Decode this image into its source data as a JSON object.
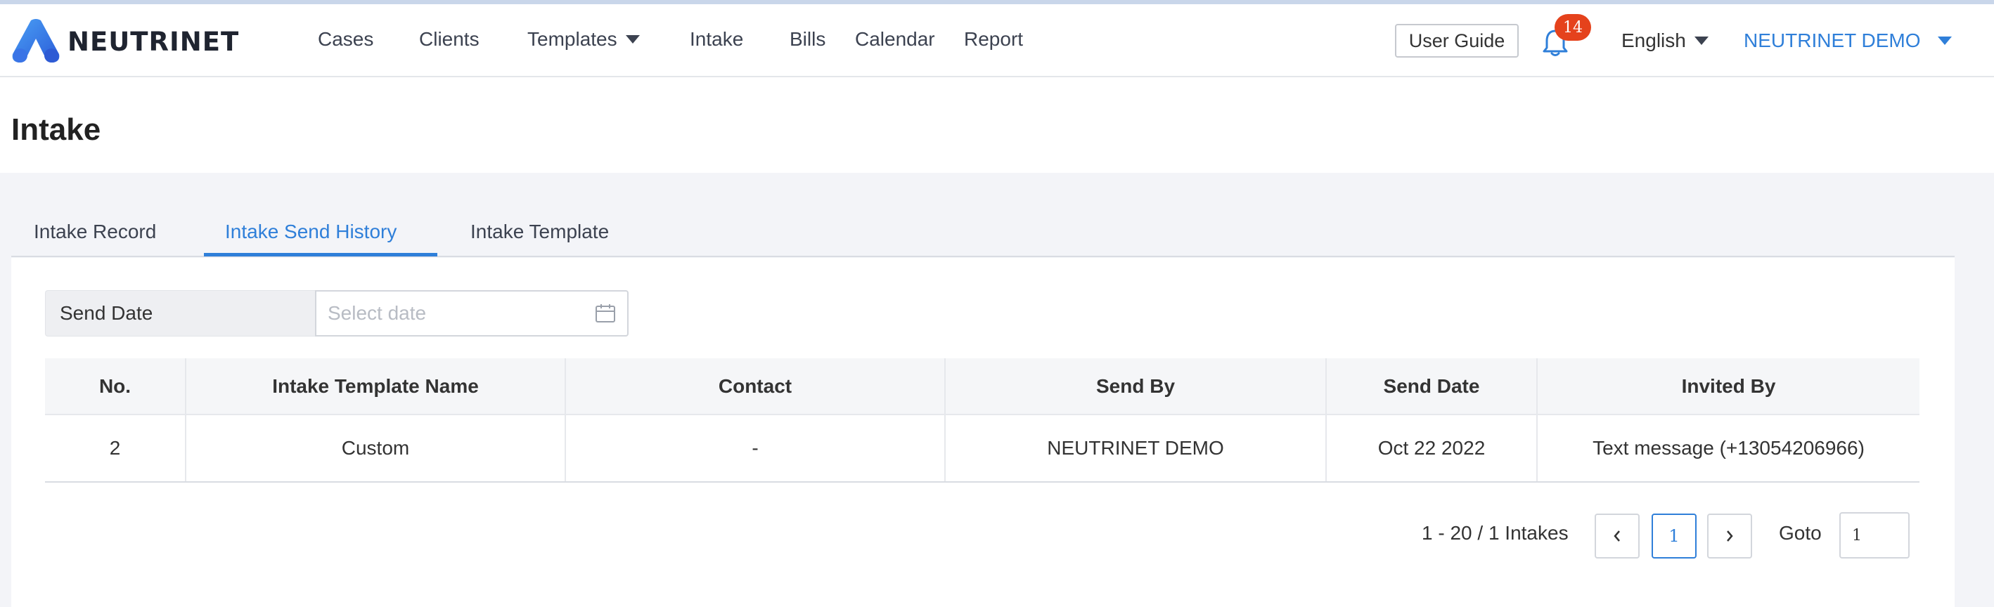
{
  "app": {
    "logo_text": "NEUTRINET"
  },
  "nav": {
    "items": [
      {
        "label": "Cases"
      },
      {
        "label": "Clients"
      },
      {
        "label": "Templates"
      },
      {
        "label": "Intake"
      },
      {
        "label": "Bills"
      },
      {
        "label": "Calendar"
      },
      {
        "label": "Report"
      }
    ]
  },
  "header": {
    "user_guide": "User Guide",
    "notification_count": "14",
    "language": "English",
    "user_name": "NEUTRINET DEMO"
  },
  "page": {
    "title": "Intake"
  },
  "tabs": [
    {
      "label": "Intake Record",
      "active": false
    },
    {
      "label": "Intake Send History",
      "active": true
    },
    {
      "label": "Intake Template",
      "active": false
    }
  ],
  "filter": {
    "label": "Send Date",
    "placeholder": "Select date"
  },
  "table": {
    "headers": [
      "No.",
      "Intake Template Name",
      "Contact",
      "Send By",
      "Send Date",
      "Invited By"
    ],
    "rows": [
      [
        "2",
        "Custom",
        "-",
        "NEUTRINET DEMO",
        "Oct 22 2022",
        "Text message (+13054206966)"
      ]
    ]
  },
  "pagination": {
    "range_text": "1 - 20 / 1 Intakes",
    "current_page": "1",
    "goto_label": "Goto",
    "goto_value": "1"
  },
  "colors": {
    "accent": "#2f7fd9",
    "badge": "#e5421c",
    "content_bg": "#f3f4f8"
  }
}
